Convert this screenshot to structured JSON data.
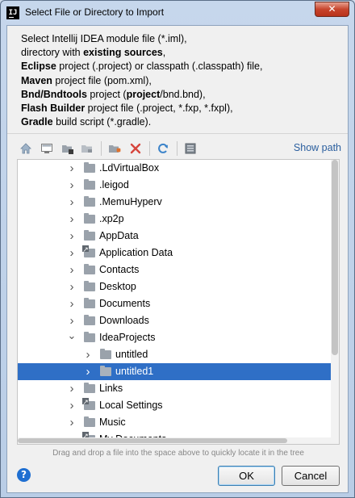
{
  "window": {
    "title": "Select File or Directory to Import",
    "app_icon": "IJ",
    "close_glyph": "✕"
  },
  "description": {
    "lines": [
      [
        {
          "t": "Select Intellij IDEA module file (*.iml),",
          "b": false
        }
      ],
      [
        {
          "t": "directory with ",
          "b": false
        },
        {
          "t": "existing sources",
          "b": true
        },
        {
          "t": ",",
          "b": false
        }
      ],
      [
        {
          "t": "Eclipse",
          "b": true
        },
        {
          "t": " project (.project) or classpath (.classpath) file,",
          "b": false
        }
      ],
      [
        {
          "t": "Maven",
          "b": true
        },
        {
          "t": " project file (pom.xml),",
          "b": false
        }
      ],
      [
        {
          "t": "Bnd/Bndtools",
          "b": true
        },
        {
          "t": " project (",
          "b": false
        },
        {
          "t": "project",
          "b": true
        },
        {
          "t": "/bnd.bnd),",
          "b": false
        }
      ],
      [
        {
          "t": "Flash Builder",
          "b": true
        },
        {
          "t": " project file (.project, *.fxp, *.fxpl),",
          "b": false
        }
      ],
      [
        {
          "t": "Gradle",
          "b": true
        },
        {
          "t": " build script (*.gradle).",
          "b": false
        }
      ]
    ]
  },
  "toolbar": {
    "show_path_label": "Show path",
    "icons": [
      "home-icon",
      "desktop-icon",
      "project-folder-icon",
      "module-folder-icon",
      "new-folder-icon",
      "delete-icon",
      "refresh-icon",
      "toggle-hidden-icon"
    ]
  },
  "tree": {
    "selected_index": 12,
    "rows": [
      {
        "label": ".LdVirtualBox",
        "depth": 1,
        "expanded": false,
        "link": false
      },
      {
        "label": ".leigod",
        "depth": 1,
        "expanded": false,
        "link": false
      },
      {
        "label": ".MemuHyperv",
        "depth": 1,
        "expanded": false,
        "link": false
      },
      {
        "label": ".xp2p",
        "depth": 1,
        "expanded": false,
        "link": false
      },
      {
        "label": "AppData",
        "depth": 1,
        "expanded": false,
        "link": false
      },
      {
        "label": "Application Data",
        "depth": 1,
        "expanded": false,
        "link": true
      },
      {
        "label": "Contacts",
        "depth": 1,
        "expanded": false,
        "link": false
      },
      {
        "label": "Desktop",
        "depth": 1,
        "expanded": false,
        "link": false
      },
      {
        "label": "Documents",
        "depth": 1,
        "expanded": false,
        "link": false
      },
      {
        "label": "Downloads",
        "depth": 1,
        "expanded": false,
        "link": false
      },
      {
        "label": "IdeaProjects",
        "depth": 1,
        "expanded": true,
        "link": false
      },
      {
        "label": "untitled",
        "depth": 2,
        "expanded": false,
        "link": false
      },
      {
        "label": "untitled1",
        "depth": 2,
        "expanded": false,
        "link": false
      },
      {
        "label": "Links",
        "depth": 1,
        "expanded": false,
        "link": false
      },
      {
        "label": "Local Settings",
        "depth": 1,
        "expanded": false,
        "link": true
      },
      {
        "label": "Music",
        "depth": 1,
        "expanded": false,
        "link": false
      },
      {
        "label": "My Documents",
        "depth": 1,
        "expanded": false,
        "link": true
      }
    ]
  },
  "hint": "Drag and drop a file into the space above to quickly locate it in the tree",
  "buttons": {
    "help": "?",
    "ok": "OK",
    "cancel": "Cancel"
  }
}
